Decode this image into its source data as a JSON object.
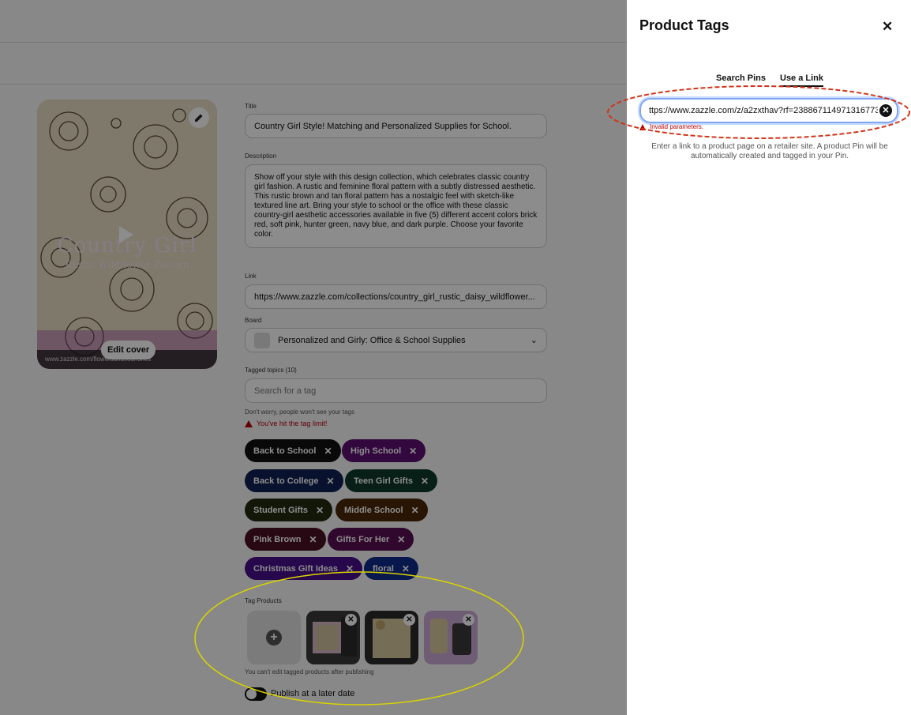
{
  "form": {
    "title_label": "Title",
    "title_value": "Country Girl Style! Matching and Personalized Supplies for School.",
    "description_label": "Description",
    "description_value": "Show off your style with this design collection, which celebrates classic country girl fashion. A rustic and feminine floral pattern with a subtly distressed aesthetic. This rustic brown and tan floral pattern has a nostalgic feel with sketch-like textured line art. Bring your style to school or the office with these classic country-girl aesthetic accessories available in five (5) different accent colors brick red, soft pink, hunter green, navy blue, and dark purple. Choose your favorite color.",
    "link_label": "Link",
    "link_value": "https://www.zazzle.com/collections/country_girl_rustic_daisy_wildflower...",
    "board_label": "Board",
    "board_value": "Personalized and Girly: Office & School Supplies",
    "tagged_topics_label": "Tagged topics (10)",
    "tag_search_placeholder": "Search for a tag",
    "tag_hint": "Don't worry, people won't see your tags",
    "tag_limit_error": "You've hit the tag limit!",
    "tags": [
      {
        "label": "Back to School",
        "color": "#111111"
      },
      {
        "label": "High School",
        "color": "#5c0f73"
      },
      {
        "label": "Back to College",
        "color": "#0f1f52"
      },
      {
        "label": "Teen Girl Gifts",
        "color": "#0f3a2b"
      },
      {
        "label": "Student Gifts",
        "color": "#222a0f"
      },
      {
        "label": "Middle School",
        "color": "#4a2708"
      },
      {
        "label": "Pink Brown",
        "color": "#4a0f22"
      },
      {
        "label": "Gifts For Her",
        "color": "#5a0f52"
      },
      {
        "label": "Christmas Gift Ideas",
        "color": "#4a0f8a"
      },
      {
        "label": "floral",
        "color": "#0f2a8a"
      }
    ],
    "tag_products_label": "Tag Products",
    "tag_products_hint": "You can't edit tagged products after publishing",
    "publish_later_label": "Publish at a later date"
  },
  "cover": {
    "title": "Country Girl",
    "subtitle": "Rustic Wildflower Pattern",
    "footer": "www.zazzle.com/flowersandflourishes",
    "edit_cover_label": "Edit cover"
  },
  "panel": {
    "title": "Product Tags",
    "tab_search": "Search Pins",
    "tab_link": "Use a Link",
    "url_value": "ttps://www.zazzle.com/z/a2zxthav?rf=238867114971316773",
    "error": "Invalid parameters.",
    "info": "Enter a link to a product page on a retailer site. A product Pin will be automatically created and tagged in your Pin."
  },
  "colors": {
    "annotation_red": "#d2341a",
    "annotation_yellow": "#d8d400",
    "error_red": "#b60000",
    "focus_blue": "#7ea6f5"
  }
}
